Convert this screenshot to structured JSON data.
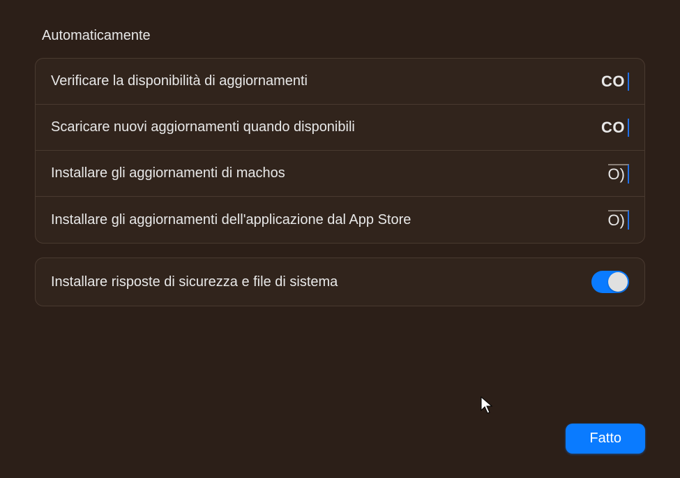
{
  "header": {
    "title": "Automaticamente"
  },
  "group1": {
    "rows": [
      {
        "label": "Verificare la disponibilità di aggiornamenti",
        "state_text": "CO"
      },
      {
        "label": "Scaricare nuovi aggiornamenti quando disponibili",
        "state_text": "CO"
      },
      {
        "label": "Installare gli aggiornamenti di machos",
        "state_text": "O)"
      },
      {
        "label": "Installare gli aggiornamenti dell'applicazione dal App Store",
        "state_text": "O)"
      }
    ]
  },
  "group2": {
    "row": {
      "label": "Installare risposte di sicurezza e file di sistema",
      "toggle_on": true
    }
  },
  "footer": {
    "done_label": "Fatto"
  }
}
